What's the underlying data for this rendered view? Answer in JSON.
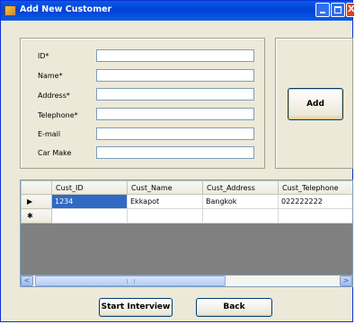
{
  "window": {
    "title": "Add New Customer",
    "close_glyph": "X"
  },
  "form": {
    "fields": [
      {
        "label": "ID*",
        "value": ""
      },
      {
        "label": "Name*",
        "value": ""
      },
      {
        "label": "Address*",
        "value": ""
      },
      {
        "label": "Telephone*",
        "value": ""
      },
      {
        "label": "E-mail",
        "value": ""
      },
      {
        "label": "Car Make",
        "value": ""
      }
    ],
    "add_label": "Add"
  },
  "grid": {
    "columns": [
      "Cust_ID",
      "Cust_Name",
      "Cust_Address",
      "Cust_Telephone"
    ],
    "rows": [
      {
        "marker": "▶",
        "cells": [
          "1234",
          "Ekkapot",
          "Bangkok",
          "022222222"
        ]
      },
      {
        "marker": "✱",
        "cells": [
          "",
          "",
          "",
          ""
        ]
      }
    ],
    "scroll_left": "<",
    "scroll_right": ">"
  },
  "footer": {
    "start_label": "Start Interview",
    "back_label": "Back"
  },
  "colors": {
    "titlebar": "#0a5ae6",
    "selection": "#316ac5",
    "window_bg": "#ece9d8"
  }
}
